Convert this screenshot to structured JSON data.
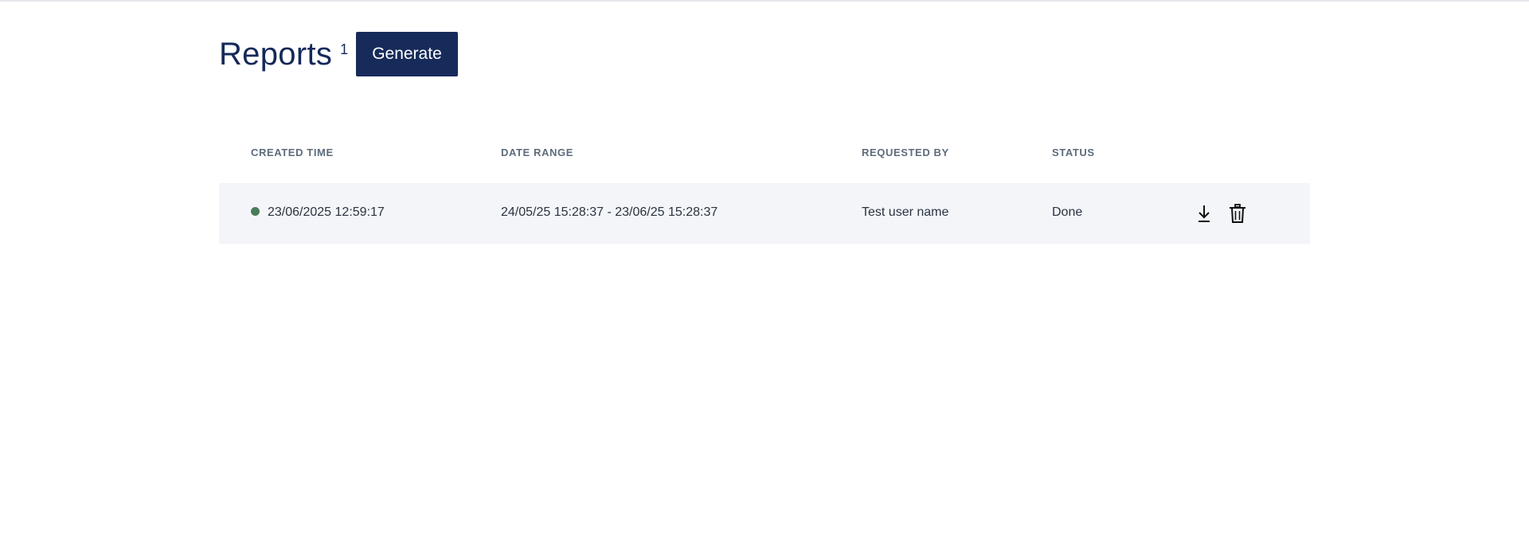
{
  "header": {
    "title": "Reports",
    "count": "1",
    "generate_label": "Generate"
  },
  "table": {
    "columns": {
      "created": "CREATED TIME",
      "range": "DATE RANGE",
      "requested": "REQUESTED BY",
      "status": "STATUS"
    },
    "rows": [
      {
        "created": "23/06/2025 12:59:17",
        "range": "24/05/25 15:28:37 - 23/06/25 15:28:37",
        "requested": "Test user name",
        "status": "Done",
        "indicator_color": "#4a7c59",
        "actions": [
          "download-icon",
          "trash-icon"
        ]
      }
    ]
  },
  "colors": {
    "brand": "#172b5b",
    "row_background": "#f3f5f9"
  }
}
